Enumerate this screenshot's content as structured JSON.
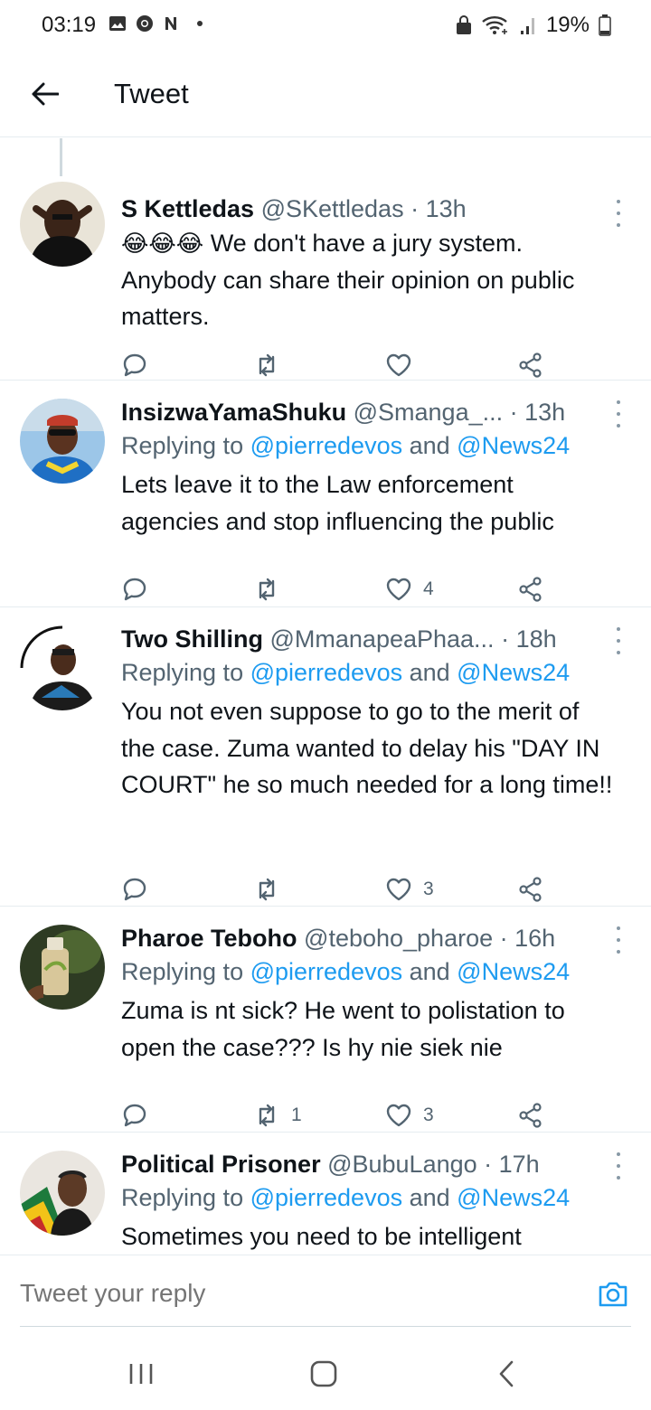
{
  "status_bar": {
    "time": "03:19",
    "battery": "19%",
    "left_icons": [
      "gallery-icon",
      "chrome-icon",
      "news-n-icon"
    ],
    "right_icons": [
      "lock-sim-icon",
      "wifi-icon",
      "signal-icon",
      "battery-icon"
    ]
  },
  "header": {
    "title": "Tweet"
  },
  "colors": {
    "link": "#1d9bf0",
    "secondary_text": "#536471",
    "primary_text": "#0f1419",
    "divider": "#e6ecf0"
  },
  "tweets": [
    {
      "name": "S Kettledas",
      "handle": "@SKettledas",
      "sep": " · ",
      "time": "13h",
      "emoji": [
        "😂",
        "😂",
        "😂"
      ],
      "text": "We don't have a jury system. Anybody can share their opinion on public matters.",
      "replies": "",
      "retweets": "",
      "likes": ""
    },
    {
      "name": "InsizwaYamaShuku",
      "handle": "@Smanga_...",
      "sep": " · ",
      "time": "13h",
      "replying_prefix": "Replying to ",
      "mention1": "@pierredevos",
      "and": " and ",
      "mention2": "@News24",
      "text": "Lets leave it to the Law enforcement agencies and stop influencing the public",
      "replies": "",
      "retweets": "",
      "likes": "4"
    },
    {
      "name": "Two Shilling",
      "handle": "@MmanapeaPhaa...",
      "sep": " · ",
      "time": "18h",
      "replying_prefix": "Replying to ",
      "mention1": "@pierredevos",
      "and": " and ",
      "mention2": "@News24",
      "text": "You not even suppose to go to the merit of the case. Zuma wanted to delay his \"DAY IN COURT\" he so much needed for a long time!!",
      "replies": "",
      "retweets": "",
      "likes": "3"
    },
    {
      "name": "Pharoe Teboho",
      "handle": "@teboho_pharoe",
      "sep": " · ",
      "time": "16h",
      "replying_prefix": "Replying to ",
      "mention1": "@pierredevos",
      "and": " and ",
      "mention2": "@News24",
      "text": "Zuma is nt sick? He went to polistation to open the case??? Is hy nie siek nie",
      "replies": "",
      "retweets": "1",
      "likes": "3"
    },
    {
      "name": "Political Prisoner",
      "handle": "@BubuLango",
      "sep": " · ",
      "time": "17h",
      "replying_prefix": "Replying to ",
      "mention1": "@pierredevos",
      "and": " and ",
      "mention2": "@News24",
      "text": "Sometimes you need to be intelligent",
      "replies": "",
      "retweets": "",
      "likes": ""
    }
  ],
  "reply_box": {
    "placeholder": "Tweet your reply"
  },
  "nav": {
    "buttons": [
      "recents-icon",
      "home-icon",
      "back-icon"
    ]
  }
}
